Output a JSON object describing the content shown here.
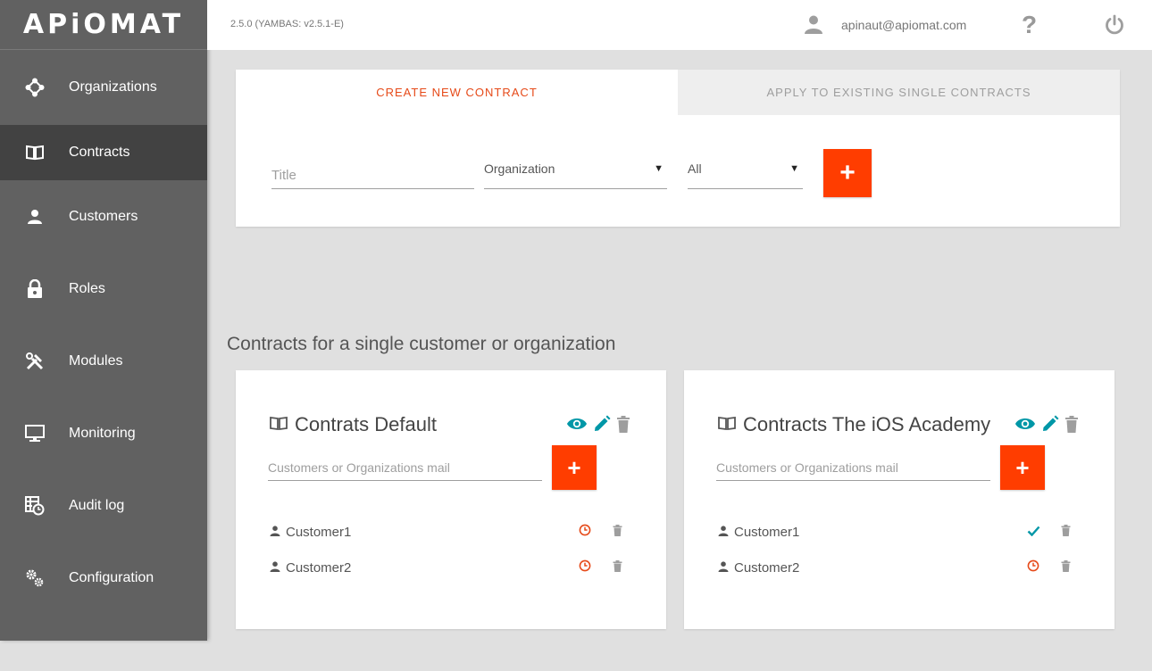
{
  "app": {
    "logo": "APiOMAT",
    "version": "2.5.0 (YAMBAS: v2.5.1-E)"
  },
  "header": {
    "user_email": "apinaut@apiomat.com",
    "help_label": "?"
  },
  "sidebar": {
    "items": [
      {
        "label": "Organizations",
        "icon": "organizations-icon"
      },
      {
        "label": "Contracts",
        "icon": "book-icon",
        "active": true
      },
      {
        "label": "Customers",
        "icon": "person-icon"
      },
      {
        "label": "Roles",
        "icon": "lock-icon"
      },
      {
        "label": "Modules",
        "icon": "tools-icon"
      },
      {
        "label": "Monitoring",
        "icon": "monitor-icon"
      },
      {
        "label": "Audit log",
        "icon": "audit-log-icon"
      },
      {
        "label": "Configuration",
        "icon": "gears-icon"
      }
    ]
  },
  "create_panel": {
    "tabs": [
      {
        "label": "CREATE NEW CONTRACT",
        "active": true
      },
      {
        "label": "APPLY TO EXISTING SINGLE CONTRACTS",
        "active": false
      }
    ],
    "title_placeholder": "Title",
    "organization_value": "Organization",
    "scope_value": "All",
    "add_label": "+"
  },
  "section_title": "Contracts for a single customer or organization",
  "cards": [
    {
      "title": "Contrats Default",
      "mail_placeholder": "Customers or Organizations mail",
      "add_label": "+",
      "rows": [
        {
          "name": "Customer1",
          "status": "pending"
        },
        {
          "name": "Customer2",
          "status": "pending"
        }
      ]
    },
    {
      "title": "Contracts The iOS Academy",
      "mail_placeholder": "Customers or Organizations mail",
      "add_label": "+",
      "rows": [
        {
          "name": "Customer1",
          "status": "approved"
        },
        {
          "name": "Customer2",
          "status": "pending"
        }
      ]
    }
  ],
  "colors": {
    "accent": "#ff3d00",
    "tab_active": "#e64a19",
    "teal": "#0097a7",
    "sidebar": "#616161",
    "sidebar_active": "#424242"
  }
}
